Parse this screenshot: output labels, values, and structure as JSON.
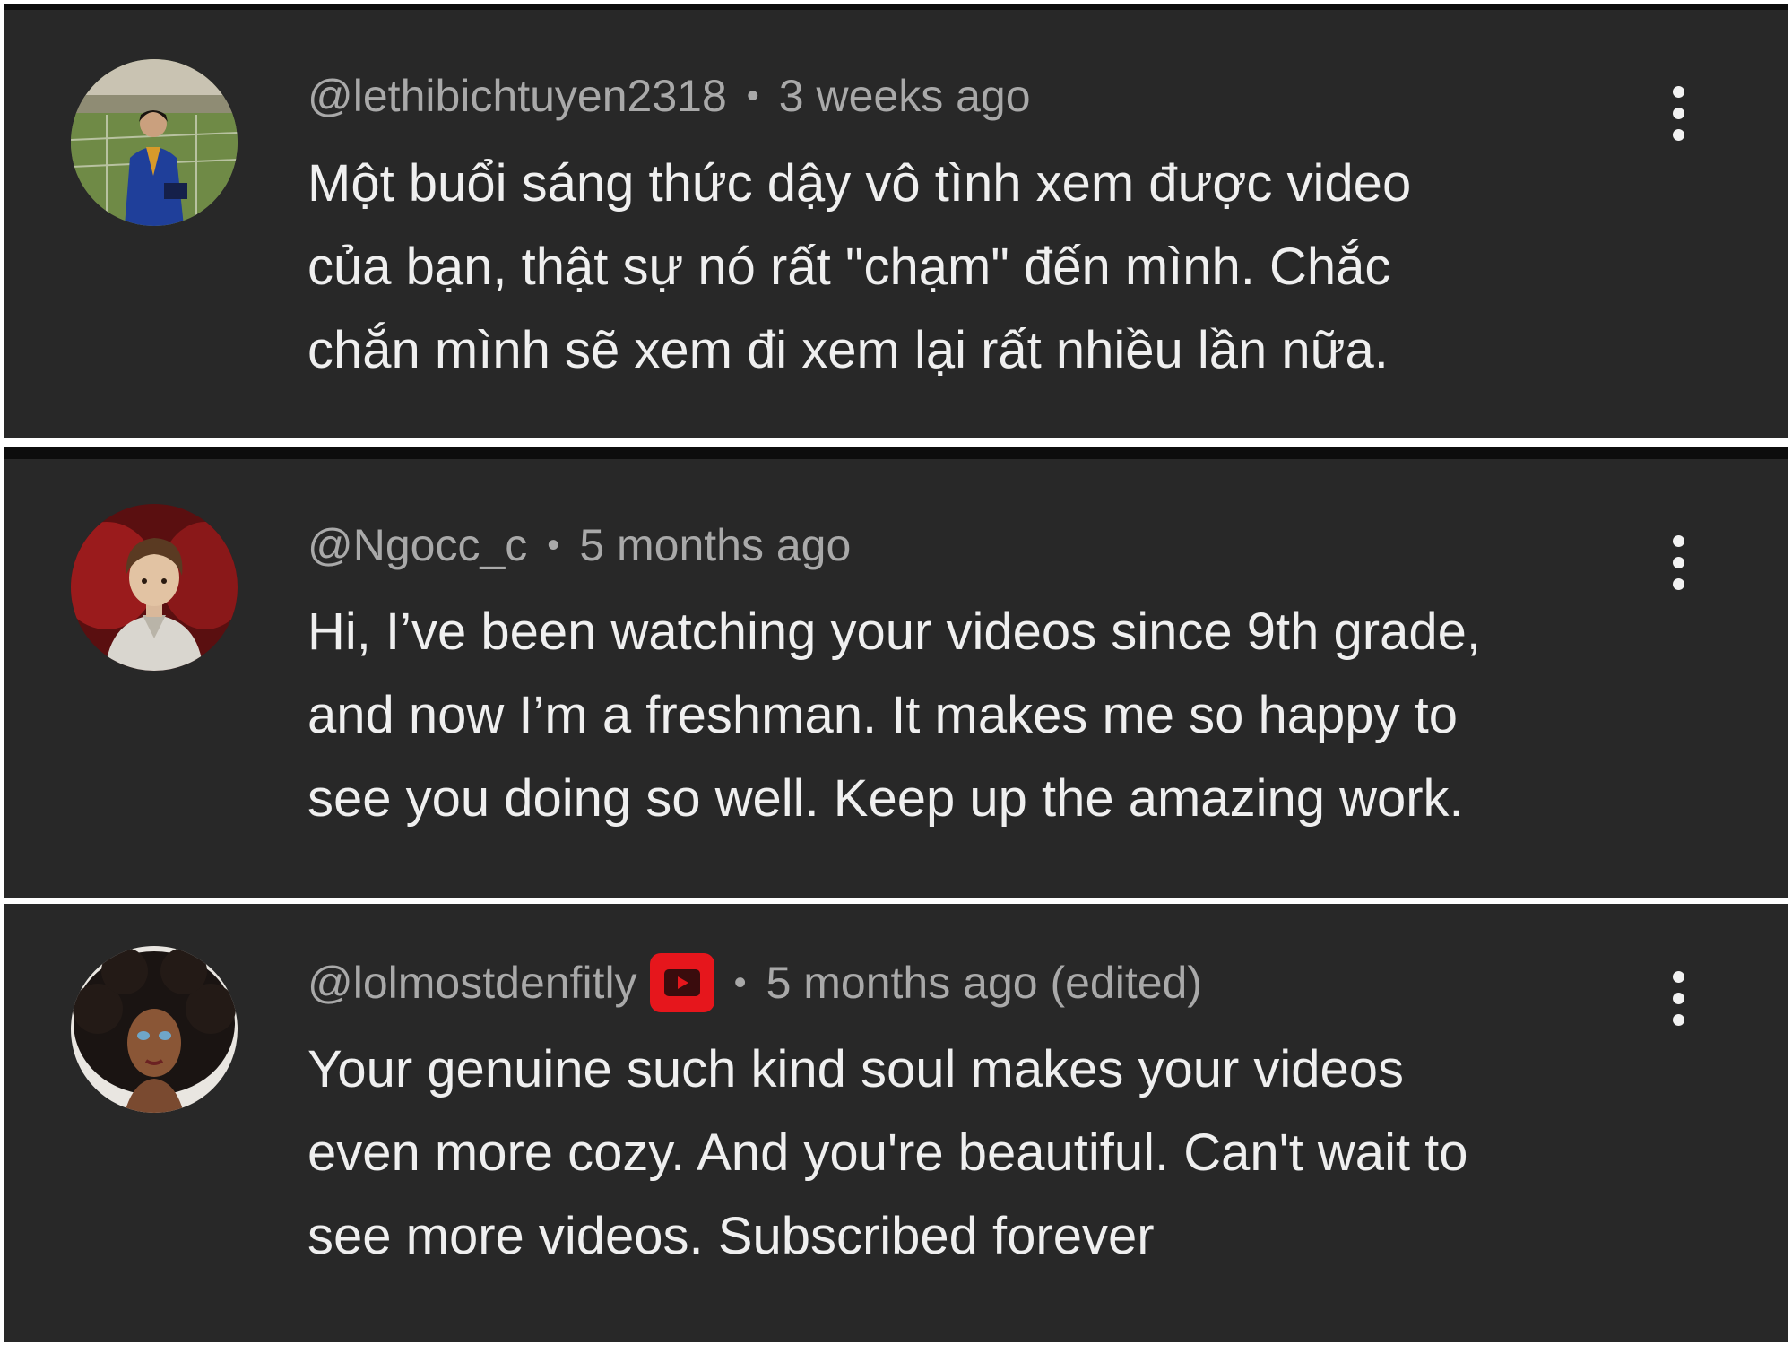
{
  "comments": [
    {
      "handle": "@lethibichtuyen2318",
      "time": "3 weeks ago",
      "text": "Một buổi sáng thức dậy vô tình xem được video\ncủa bạn, thật sự nó rất \"chạm\" đến mình. Chắc\nchắn mình sẽ xem đi xem lại rất nhiều lần nữa.",
      "avatar_icon": "graduate-photo-avatar",
      "menu_icon": "more-vert-icon"
    },
    {
      "handle": "@Ngocc_c",
      "time": "5 months ago",
      "text": "Hi, I’ve been watching your videos since 9th grade,\nand now I’m a freshman. It makes me so happy to\nsee you doing so well. Keep up the amazing work.",
      "avatar_icon": "anime-character-avatar",
      "menu_icon": "more-vert-icon"
    },
    {
      "handle": "@lolmostdenfitly",
      "time": "5 months ago (edited)",
      "text": "Your genuine such kind soul makes your videos\neven more cozy. And you're beautiful. Can't wait to\nsee more videos. Subscribed forever",
      "avatar_icon": "doll-portrait-avatar",
      "badge_icon": "youtube-member-badge-icon",
      "menu_icon": "more-vert-icon"
    }
  ],
  "separator": "•",
  "colors": {
    "panel_background": "#282828",
    "meta_text": "#a9a9a9",
    "comment_text": "#efefef",
    "badge": "#e6161c",
    "divider": "#ffffff"
  }
}
